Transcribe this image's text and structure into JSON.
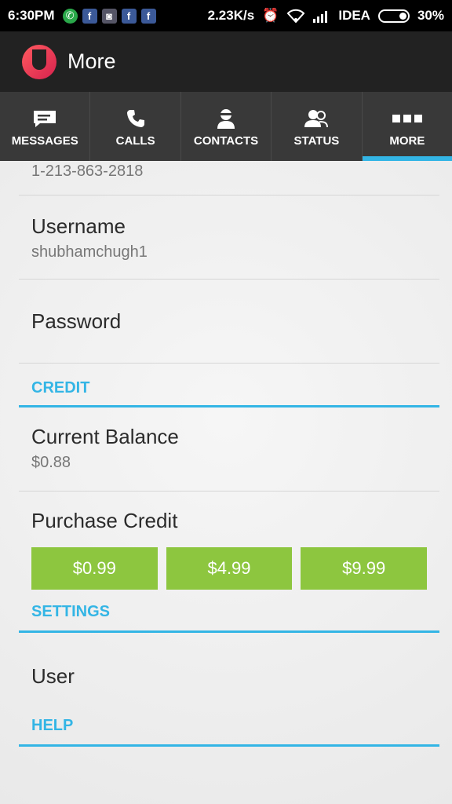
{
  "status_bar": {
    "time": "6:30PM",
    "speed": "2.23K/s",
    "carrier": "IDEA",
    "battery": "30%",
    "notification_icons": [
      "whatsapp-icon",
      "facebook-icon",
      "app-icon",
      "facebook-icon",
      "facebook-icon"
    ]
  },
  "app_bar": {
    "title": "More"
  },
  "tabs": [
    {
      "label": "MESSAGES",
      "icon": "message-icon",
      "active": false
    },
    {
      "label": "CALLS",
      "icon": "phone-icon",
      "active": false
    },
    {
      "label": "CONTACTS",
      "icon": "contact-icon",
      "active": false
    },
    {
      "label": "STATUS",
      "icon": "status-icon",
      "active": false
    },
    {
      "label": "MORE",
      "icon": "more-icon",
      "active": true
    }
  ],
  "account": {
    "phone_number": "1-213-863-2818",
    "username_label": "Username",
    "username_value": "shubhamchugh1",
    "password_label": "Password"
  },
  "credit": {
    "header": "CREDIT",
    "balance_label": "Current Balance",
    "balance_value": "$0.88",
    "purchase_label": "Purchase Credit",
    "options": [
      "$0.99",
      "$4.99",
      "$9.99"
    ]
  },
  "settings": {
    "header": "SETTINGS",
    "user_label": "User"
  },
  "help": {
    "header": "HELP"
  },
  "colors": {
    "accent": "#33b5e5",
    "button_green": "#8dc63f",
    "tab_bar": "#393939",
    "app_bar": "#222222"
  }
}
